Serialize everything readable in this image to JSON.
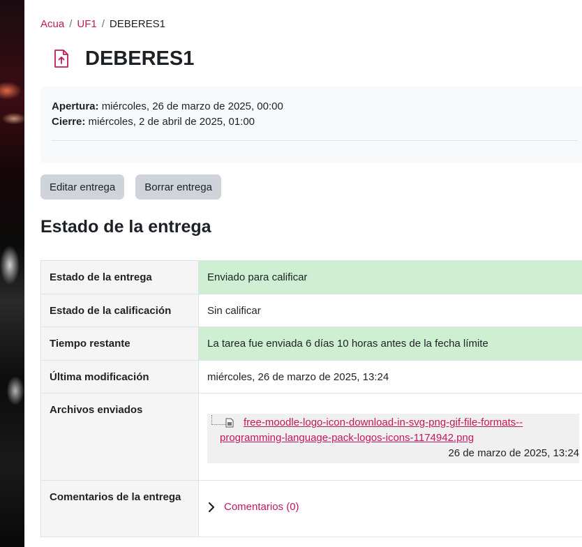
{
  "breadcrumb": {
    "item1": "Acua",
    "item2": "UF1",
    "current": "DEBERES1"
  },
  "page": {
    "title": "DEBERES1",
    "icon": "file-upload-icon"
  },
  "dates": {
    "opening_label": "Apertura:",
    "opening_value": "miércoles, 26 de marzo de 2025, 00:00",
    "closing_label": "Cierre:",
    "closing_value": "miércoles, 2 de abril de 2025, 01:00"
  },
  "buttons": {
    "edit": "Editar entrega",
    "delete": "Borrar entrega"
  },
  "section": {
    "title": "Estado de la entrega"
  },
  "table": {
    "rows": [
      {
        "label": "Estado de la entrega",
        "value": "Enviado para calificar"
      },
      {
        "label": "Estado de la calificación",
        "value": "Sin calificar"
      },
      {
        "label": "Tiempo restante",
        "value": "La tarea fue enviada 6 días 10 horas antes de la fecha límite"
      },
      {
        "label": "Última modificación",
        "value": "miércoles, 26 de marzo de 2025, 13:24"
      },
      {
        "label": "Archivos enviados"
      },
      {
        "label": "Comentarios de la entrega"
      }
    ],
    "file": {
      "name_line1": "free-moodle-logo-icon-download-in-svg-png-gif-file-formats--",
      "name_line2": "programming-language-pack-logos-icons-1174942.png",
      "date": "26 de marzo de 2025, 13:24"
    },
    "comments": "Comentarios (0)"
  },
  "colors": {
    "accent": "#c2185b",
    "success_bg": "#cfefd3",
    "button_bg": "#ced4da"
  }
}
